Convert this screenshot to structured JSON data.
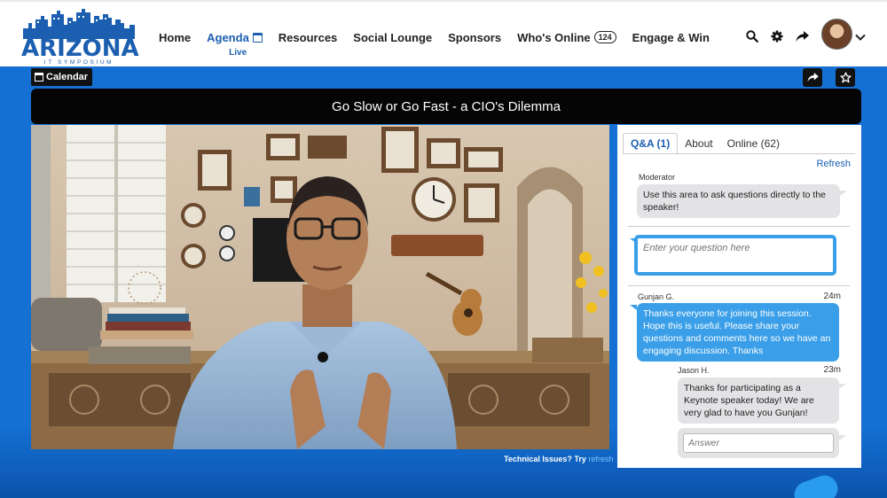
{
  "header": {
    "logo_text": "ARIZONA",
    "logo_subtext": "IT SYMPOSIUM",
    "nav": [
      {
        "label": "Home"
      },
      {
        "label": "Agenda",
        "sublabel": "Live"
      },
      {
        "label": "Resources"
      },
      {
        "label": "Social Lounge"
      },
      {
        "label": "Sponsors"
      },
      {
        "label": "Who's Online",
        "badge": "124"
      },
      {
        "label": "Engage & Win"
      }
    ],
    "icons": [
      "search-icon",
      "gear-icon",
      "share-icon"
    ]
  },
  "toolbar": {
    "calendar_label": "Calendar"
  },
  "session": {
    "title": "Go Slow or Go Fast - a CIO's Dilemma",
    "tech_issues_text": "Technical Issues? Try",
    "tech_issues_link": "refresh"
  },
  "panel": {
    "tabs": [
      {
        "label": "Q&A (1)",
        "active": true
      },
      {
        "label": "About"
      },
      {
        "label": "Online (62)"
      }
    ],
    "refresh_label": "Refresh",
    "moderator": {
      "name": "Moderator",
      "text": "Use this area to ask questions directly to the speaker!"
    },
    "question_placeholder": "Enter your question here",
    "messages": [
      {
        "author": "Gunjan G.",
        "time": "24m",
        "text": "Thanks everyone for joining this session. Hope this is useful. Please share your questions and comments here so we have an engaging discussion. Thanks"
      },
      {
        "author": "Jason H.",
        "time": "23m",
        "text": "Thanks for participating as a Keynote speaker today! We are very glad to have you Gunjan!"
      }
    ],
    "answer_placeholder": "Answer"
  },
  "colors": {
    "brand_blue": "#1c5fb0",
    "bubble_blue": "#3a9fe8",
    "stage_blue": "#1470d2"
  }
}
